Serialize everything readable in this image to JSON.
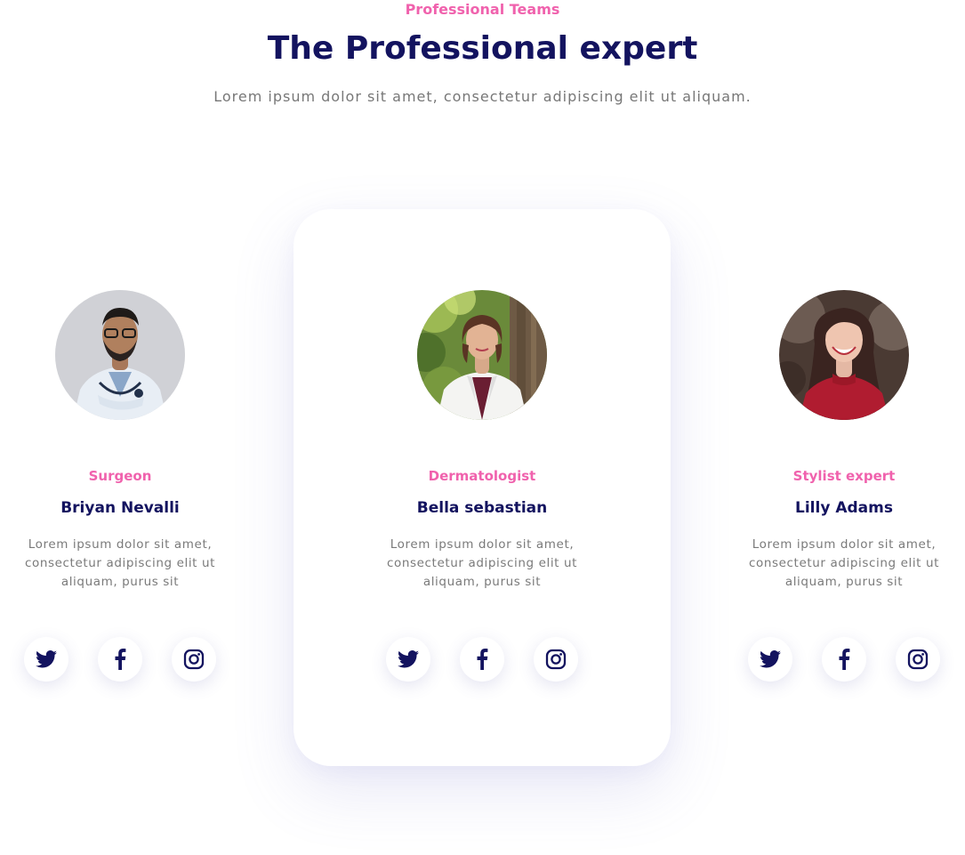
{
  "section": {
    "eyebrow": "Professional Teams",
    "title": "The Professional expert",
    "subtitle": "Lorem ipsum dolor sit amet, consectetur adipiscing elit ut aliquam."
  },
  "members": [
    {
      "role": "Surgeon",
      "name": "Briyan Nevalli",
      "description": "Lorem ipsum dolor sit amet, consectetur adipiscing elit ut aliquam, purus sit",
      "socials": [
        "twitter-icon",
        "facebook-icon",
        "instagram-icon"
      ]
    },
    {
      "role": "Dermatologist",
      "name": "Bella sebastian",
      "description": "Lorem ipsum dolor sit amet, consectetur adipiscing elit ut aliquam, purus sit",
      "socials": [
        "twitter-icon",
        "facebook-icon",
        "instagram-icon"
      ]
    },
    {
      "role": "Stylist expert",
      "name": "Lilly Adams",
      "description": "Lorem ipsum dolor sit amet, consectetur adipiscing elit ut aliquam, purus sit",
      "socials": [
        "twitter-icon",
        "facebook-icon",
        "instagram-icon"
      ]
    }
  ],
  "colors": {
    "accent": "#f062ad",
    "heading": "#13135f",
    "body_text": "#7a7a7a",
    "icon": "#13135f"
  }
}
